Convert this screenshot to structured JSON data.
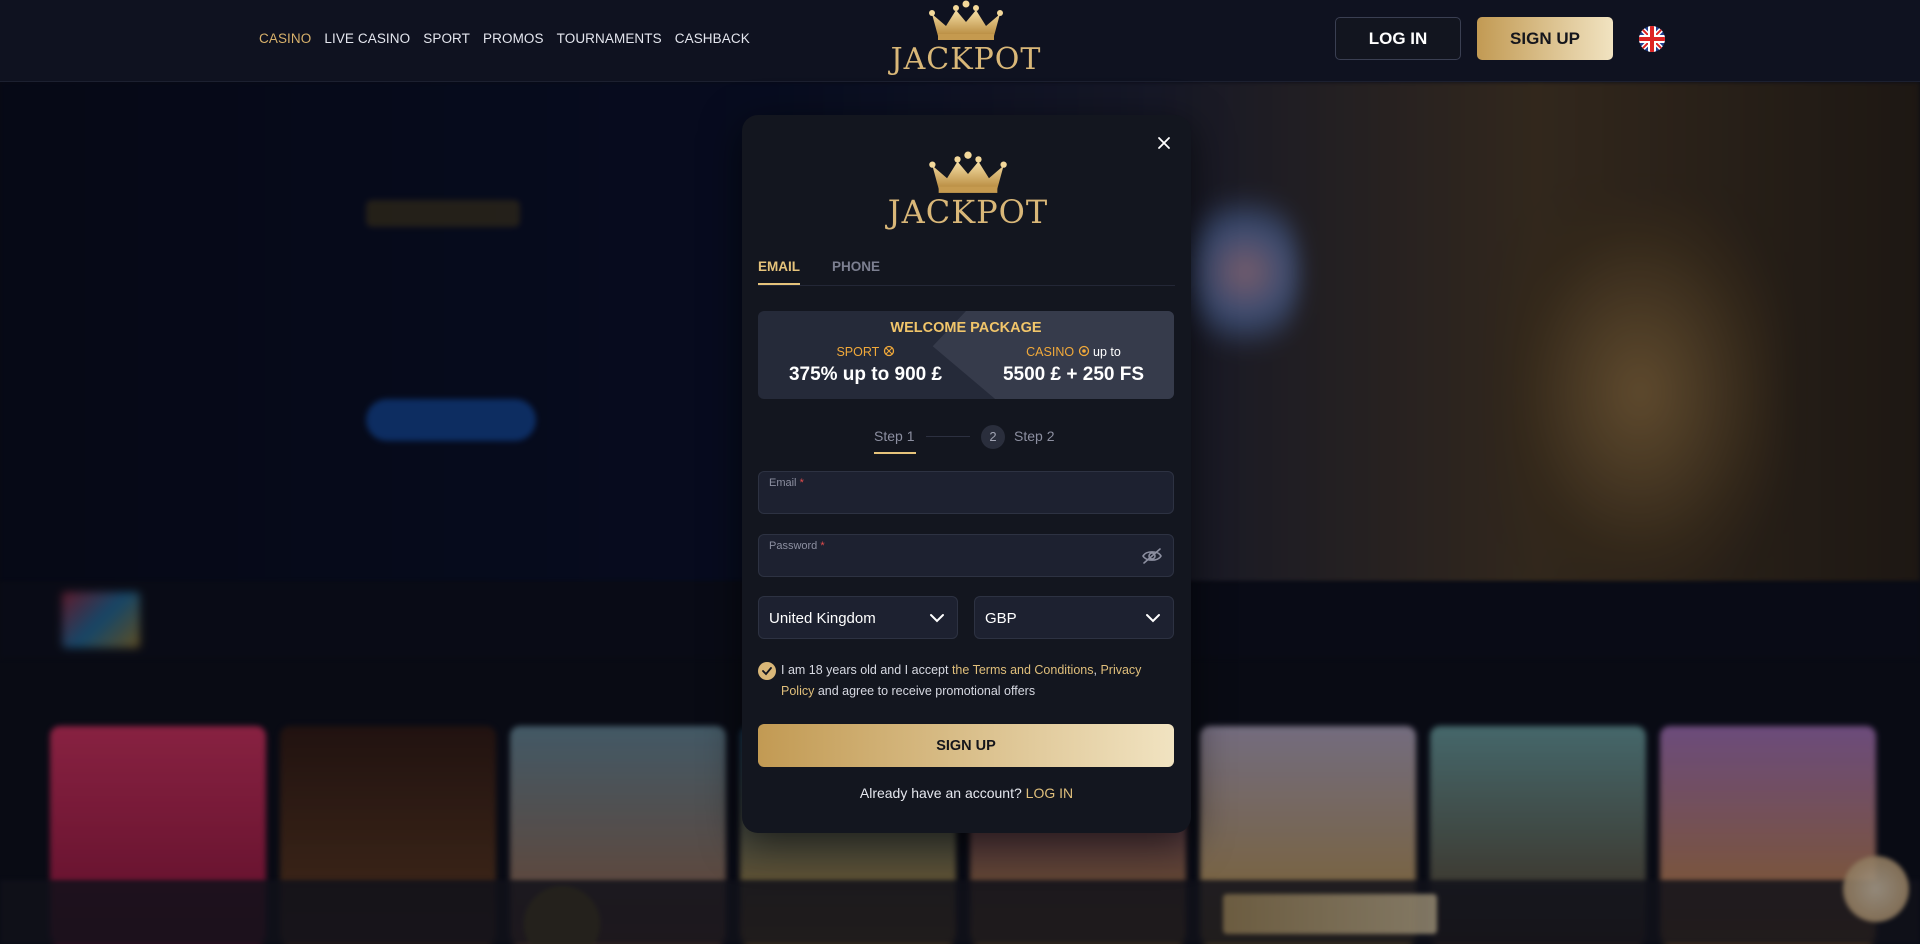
{
  "header": {
    "nav": [
      "CASINO",
      "LIVE CASINO",
      "SPORT",
      "PROMOS",
      "TOURNAMENTS",
      "CASHBACK"
    ],
    "logo_text": "JACKPOT",
    "login_label": "LOG IN",
    "signup_label": "SIGN UP"
  },
  "modal": {
    "logo_text": "JACKPOT",
    "tabs": [
      "EMAIL",
      "PHONE"
    ],
    "promo": {
      "title": "WELCOME PACKAGE",
      "left_label": "SPORT",
      "left_value": "375% up to 900 £",
      "right_label": "CASINO",
      "right_suffix": "up to",
      "right_value": "5500 £ + 250 FS"
    },
    "steps": {
      "step1": "Step 1",
      "step2_num": "2",
      "step2": "Step 2"
    },
    "email": {
      "label": "Email",
      "required": "*",
      "value": ""
    },
    "password": {
      "label": "Password",
      "required": "*",
      "value": ""
    },
    "country": "United Kingdom",
    "currency": "GBP",
    "consent": {
      "text1": "I am 18 years old and I accept",
      "terms": "the Terms and Conditions",
      "comma": ",",
      "privacy": "Privacy Policy",
      "text2": "and agree to receive promotional offers"
    },
    "submit_label": "SIGN UP",
    "already_text": "Already have an account?",
    "login_link": "LOG IN"
  },
  "colors": {
    "gold": "#e5c37b",
    "background": "#0b0e1a",
    "modal": "#13161f"
  }
}
